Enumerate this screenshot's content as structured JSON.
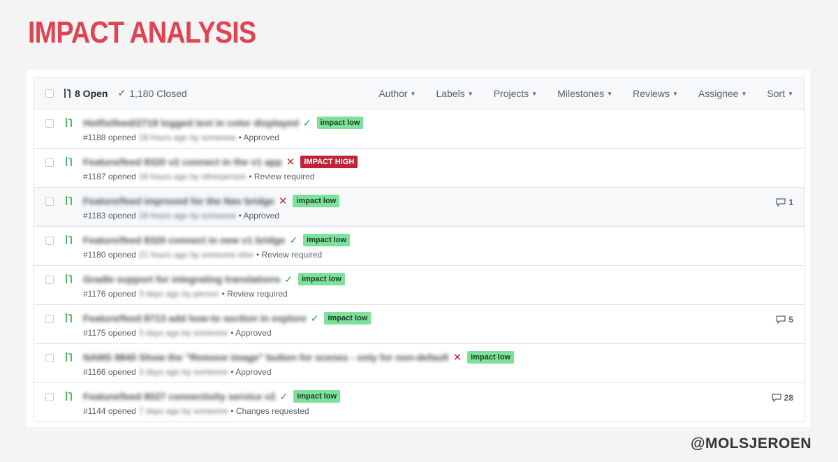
{
  "slide": {
    "title": "IMPACT ANALYSIS",
    "handle": "@MOLSJEROEN"
  },
  "colors": {
    "title": "#e04352",
    "badge_low": "#7ee19a",
    "badge_high": "#c0223a",
    "open_icon": "#28a745",
    "check": "#28a745",
    "cross": "#cb2431"
  },
  "header": {
    "open_label": "8 Open",
    "closed_label": "1,180 Closed",
    "filters": [
      "Author",
      "Labels",
      "Projects",
      "Milestones",
      "Reviews",
      "Assignee",
      "Sort"
    ]
  },
  "rows": [
    {
      "title": "Hotfix/feed/2718 logged text in color displayed",
      "status": "check",
      "label": "impact low",
      "label_type": "low",
      "meta_prefix": "#1188 opened",
      "meta_blur": "18 hours ago by someone",
      "review": "• Approved",
      "comments": ""
    },
    {
      "title": "Feature/feed 8320 v2 connect in the v1 app",
      "status": "cross",
      "label": "IMPACT HIGH",
      "label_type": "high",
      "meta_prefix": "#1187 opened",
      "meta_blur": "18 hours ago by otherperson",
      "review": "• Review required",
      "comments": ""
    },
    {
      "title": "Feature/feed improved for the Nav bridge",
      "status": "cross",
      "label": "impact low",
      "label_type": "low",
      "meta_prefix": "#1183 opened",
      "meta_blur": "18 hours ago by someone",
      "review": "• Approved",
      "comments": "1"
    },
    {
      "title": "Feature/feed 8320 connect in new v1 bridge",
      "status": "check",
      "label": "impact low",
      "label_type": "low",
      "meta_prefix": "#1180 opened",
      "meta_blur": "21 hours ago by someone else",
      "review": "• Review required",
      "comments": ""
    },
    {
      "title": "Gradle support for integrating translations",
      "status": "check",
      "label": "impact low",
      "label_type": "low",
      "meta_prefix": "#1176 opened",
      "meta_blur": "3 days ago by person",
      "review": "• Review required",
      "comments": ""
    },
    {
      "title": "Feature/feed 8713 add how-to section in explore",
      "status": "check",
      "label": "impact low",
      "label_type": "low",
      "meta_prefix": "#1175 opened",
      "meta_blur": "3 days ago by someone",
      "review": "• Approved",
      "comments": "5"
    },
    {
      "title": "NAMS 8840 Show the \"Remove image\" button for scenes - only for non-default",
      "status": "cross",
      "label": "impact low",
      "label_type": "low",
      "meta_prefix": "#1166 opened",
      "meta_blur": "3 days ago by someone",
      "review": "• Approved",
      "comments": ""
    },
    {
      "title": "Feature/feed 8027 connectivity service v2",
      "status": "check",
      "label": "impact low",
      "label_type": "low",
      "meta_prefix": "#1144 opened",
      "meta_blur": "7 days ago by someone",
      "review": "• Changes requested",
      "comments": "28"
    }
  ],
  "icons": {
    "pr": "pull-request-icon",
    "check": "check-icon",
    "cross": "x-icon",
    "comment": "comment-icon",
    "caret": "caret-down-icon"
  }
}
